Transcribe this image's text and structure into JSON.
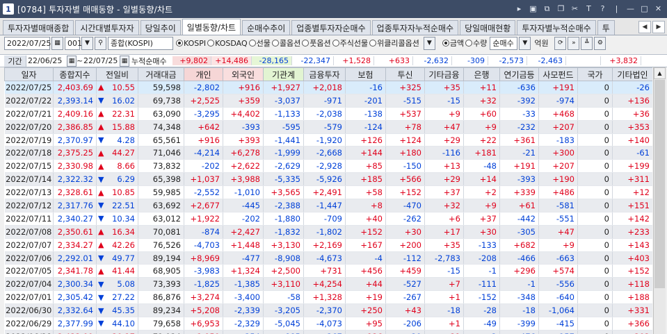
{
  "window": {
    "number": "1",
    "title": "[0784] 투자자별 매매동향 - 일별동향/차트"
  },
  "tabs": [
    "투자자별매매종합",
    "시간대별투자자",
    "당일추이",
    "일별동향/차트",
    "순매수추이",
    "업종별투자자순매수",
    "업종투자자누적순매수",
    "당일매매현황",
    "투자자별누적순매수",
    "투"
  ],
  "active_tab": 3,
  "controls": {
    "date": "2022/07/25",
    "code": "001",
    "market_name": "종합(KOSPI)",
    "radios": [
      {
        "label": "KOSPI",
        "on": true
      },
      {
        "label": "KOSDAQ",
        "on": false
      },
      {
        "label": "선물",
        "on": false
      },
      {
        "label": "콜옵션",
        "on": false
      },
      {
        "label": "풋옵션",
        "on": false
      },
      {
        "label": "주식선물",
        "on": false
      },
      {
        "label": "위클리콜옵션",
        "on": false
      }
    ],
    "unit_radios": [
      {
        "label": "금액",
        "on": true
      },
      {
        "label": "수량",
        "on": false
      }
    ],
    "select_type": "순매수",
    "unit_label": "억원"
  },
  "summary": {
    "period_label": "기간",
    "from": "22/06/25",
    "tilde": "~",
    "to": "22/07/25",
    "cum_label": "누적순매수",
    "values": [
      "+9,802",
      "+14,486",
      "-28,165",
      "-22,347",
      "+1,528",
      "+633",
      "-2,632",
      "-309",
      "-2,573",
      "-2,463",
      "",
      "+3,832"
    ]
  },
  "columns": [
    "일자",
    "종합지수",
    "전일비",
    "거래대금",
    "개인",
    "외국인",
    "기관계",
    "금융투자",
    "보험",
    "투신",
    "기타금융",
    "은행",
    "연기금등",
    "사모펀드",
    "국가",
    "기타법인"
  ],
  "rows": [
    [
      "2022/07/25",
      "2,403.69",
      "▲",
      "10.55",
      "59,598",
      "-2,802",
      "+916",
      "+1,927",
      "+2,018",
      "-16",
      "+325",
      "+35",
      "+11",
      "-636",
      "+191",
      "0",
      "-26"
    ],
    [
      "2022/07/22",
      "2,393.14",
      "▼",
      "16.02",
      "69,738",
      "+2,525",
      "+359",
      "-3,037",
      "-971",
      "-201",
      "-515",
      "-15",
      "+32",
      "-392",
      "-974",
      "0",
      "+136"
    ],
    [
      "2022/07/21",
      "2,409.16",
      "▲",
      "22.31",
      "63,090",
      "-3,295",
      "+4,402",
      "-1,133",
      "-2,038",
      "-138",
      "+537",
      "+9",
      "+60",
      "-33",
      "+468",
      "0",
      "+36"
    ],
    [
      "2022/07/20",
      "2,386.85",
      "▲",
      "15.88",
      "74,348",
      "+642",
      "-393",
      "-595",
      "-579",
      "-124",
      "+78",
      "+47",
      "+9",
      "-232",
      "+207",
      "0",
      "+353"
    ],
    [
      "2022/07/19",
      "2,370.97",
      "▼",
      "4.28",
      "65,561",
      "+916",
      "+393",
      "-1,441",
      "-1,920",
      "+126",
      "+124",
      "+29",
      "+22",
      "+361",
      "-183",
      "0",
      "+140"
    ],
    [
      "2022/07/18",
      "2,375.25",
      "▲",
      "44.27",
      "71,046",
      "-4,214",
      "+6,278",
      "-1,999",
      "-2,668",
      "+144",
      "+180",
      "-116",
      "+181",
      "-21",
      "+300",
      "0",
      "-61"
    ],
    [
      "2022/07/15",
      "2,330.98",
      "▲",
      "8.66",
      "73,832",
      "-202",
      "+2,622",
      "-2,629",
      "-2,928",
      "+85",
      "-150",
      "+13",
      "-48",
      "+191",
      "+207",
      "0",
      "+199"
    ],
    [
      "2022/07/14",
      "2,322.32",
      "▼",
      "6.29",
      "65,398",
      "+1,037",
      "+3,988",
      "-5,335",
      "-5,926",
      "+185",
      "+566",
      "+29",
      "+14",
      "-393",
      "+190",
      "0",
      "+311"
    ],
    [
      "2022/07/13",
      "2,328.61",
      "▲",
      "10.85",
      "59,985",
      "-2,552",
      "-1,010",
      "+3,565",
      "+2,491",
      "+58",
      "+152",
      "+37",
      "+2",
      "+339",
      "+486",
      "0",
      "+12"
    ],
    [
      "2022/07/12",
      "2,317.76",
      "▼",
      "22.51",
      "63,692",
      "+2,677",
      "-445",
      "-2,388",
      "-1,447",
      "+8",
      "-470",
      "+32",
      "+9",
      "+61",
      "-581",
      "0",
      "+151"
    ],
    [
      "2022/07/11",
      "2,340.27",
      "▼",
      "10.34",
      "63,012",
      "+1,922",
      "-202",
      "-1,880",
      "-709",
      "+40",
      "-262",
      "+6",
      "+37",
      "-442",
      "-551",
      "0",
      "+142"
    ],
    [
      "2022/07/08",
      "2,350.61",
      "▲",
      "16.34",
      "70,081",
      "-874",
      "+2,427",
      "-1,832",
      "-1,802",
      "+152",
      "+30",
      "+17",
      "+30",
      "-305",
      "+47",
      "0",
      "+233"
    ],
    [
      "2022/07/07",
      "2,334.27",
      "▲",
      "42.26",
      "76,526",
      "-4,703",
      "+1,448",
      "+3,130",
      "+2,169",
      "+167",
      "+200",
      "+35",
      "-133",
      "+682",
      "+9",
      "0",
      "+143"
    ],
    [
      "2022/07/06",
      "2,292.01",
      "▼",
      "49.77",
      "89,194",
      "+8,969",
      "-477",
      "-8,908",
      "-4,673",
      "-4",
      "-112",
      "-2,783",
      "-208",
      "-466",
      "-663",
      "0",
      "+403"
    ],
    [
      "2022/07/05",
      "2,341.78",
      "▲",
      "41.44",
      "68,905",
      "-3,983",
      "+1,324",
      "+2,500",
      "+731",
      "+456",
      "+459",
      "-15",
      "-1",
      "+296",
      "+574",
      "0",
      "+152"
    ],
    [
      "2022/07/04",
      "2,300.34",
      "▼",
      "5.08",
      "73,393",
      "-1,825",
      "-1,385",
      "+3,110",
      "+4,254",
      "+44",
      "-527",
      "+7",
      "-111",
      "-1",
      "-556",
      "0",
      "+118"
    ],
    [
      "2022/07/01",
      "2,305.42",
      "▼",
      "27.22",
      "86,876",
      "+3,274",
      "-3,400",
      "-58",
      "+1,328",
      "+19",
      "-267",
      "+1",
      "-152",
      "-348",
      "-640",
      "0",
      "+188"
    ],
    [
      "2022/06/30",
      "2,332.64",
      "▼",
      "45.35",
      "89,234",
      "+5,208",
      "-2,339",
      "-3,205",
      "-2,370",
      "+250",
      "+43",
      "-18",
      "-28",
      "-18",
      "-1,064",
      "0",
      "+331"
    ],
    [
      "2022/06/29",
      "2,377.99",
      "▼",
      "44.10",
      "79,658",
      "+6,953",
      "-2,329",
      "-5,045",
      "-4,073",
      "+95",
      "-206",
      "+1",
      "-49",
      "-399",
      "-415",
      "0",
      "+366"
    ],
    [
      "2022/06/28",
      "2,422.09",
      "▲",
      "20.17",
      "71,934",
      "+1,059",
      "-354",
      "-885",
      "-367",
      "+126",
      "-29",
      "+21",
      "-2",
      "-476",
      "-157",
      "0",
      "+202"
    ]
  ],
  "colors": {
    "up": "#e0001b",
    "down": "#0040d8",
    "selected_row": "#d9ecfb",
    "titlebar": "#3d4c66"
  }
}
